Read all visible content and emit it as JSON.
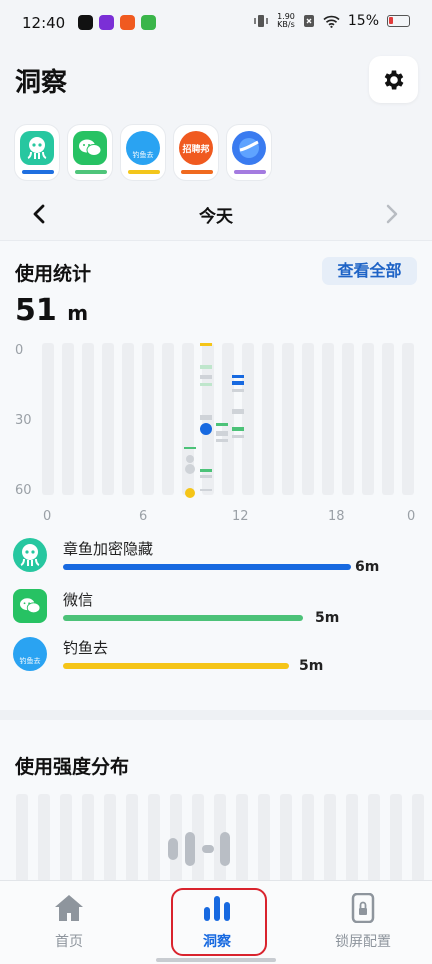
{
  "status_bar": {
    "time": "12:40",
    "net_speed": "1.90\nKB/s",
    "battery": "15%"
  },
  "header": {
    "title": "洞察"
  },
  "apps": [
    {
      "name": "octopus",
      "accent": "#1f6fe0",
      "icon_bg": "#27c7a0"
    },
    {
      "name": "wechat",
      "accent": "#4fc57a",
      "icon_bg": "#27c263"
    },
    {
      "name": "diaoyuqu",
      "accent": "#f3c61b",
      "icon_bg": "#2aa3f2",
      "text": "钓鱼去"
    },
    {
      "name": "zhaopinbang",
      "accent": "#f06a1f",
      "icon_bg": "#f05a20",
      "text": "招聘邦"
    },
    {
      "name": "browser",
      "accent": "#a47be0",
      "icon_bg": "#3a7bf0"
    }
  ],
  "date_nav": {
    "label": "今天"
  },
  "usage": {
    "title": "使用统计",
    "view_all": "查看全部",
    "total_value": "51",
    "total_unit": "m",
    "y_labels": [
      "0",
      "30",
      "60"
    ],
    "x_labels": [
      "0",
      "6",
      "12",
      "18",
      "0"
    ]
  },
  "legend": [
    {
      "name": "章鱼加密隐藏",
      "value": "6m",
      "fraction": 1.0,
      "color": "#1769e0"
    },
    {
      "name": "微信",
      "value": "5m",
      "fraction": 0.8,
      "color": "#4cc278"
    },
    {
      "name": "钓鱼去",
      "value": "5m",
      "fraction": 0.75,
      "color": "#f5c518",
      "icon_text": "钓鱼去"
    }
  ],
  "intensity": {
    "title": "使用强度分布"
  },
  "bottom_nav": [
    {
      "label": "首页",
      "icon": "home-icon",
      "active": false
    },
    {
      "label": "洞察",
      "icon": "bar-chart-icon",
      "active": true
    },
    {
      "label": "锁屏配置",
      "icon": "lock-icon",
      "active": false
    }
  ]
}
